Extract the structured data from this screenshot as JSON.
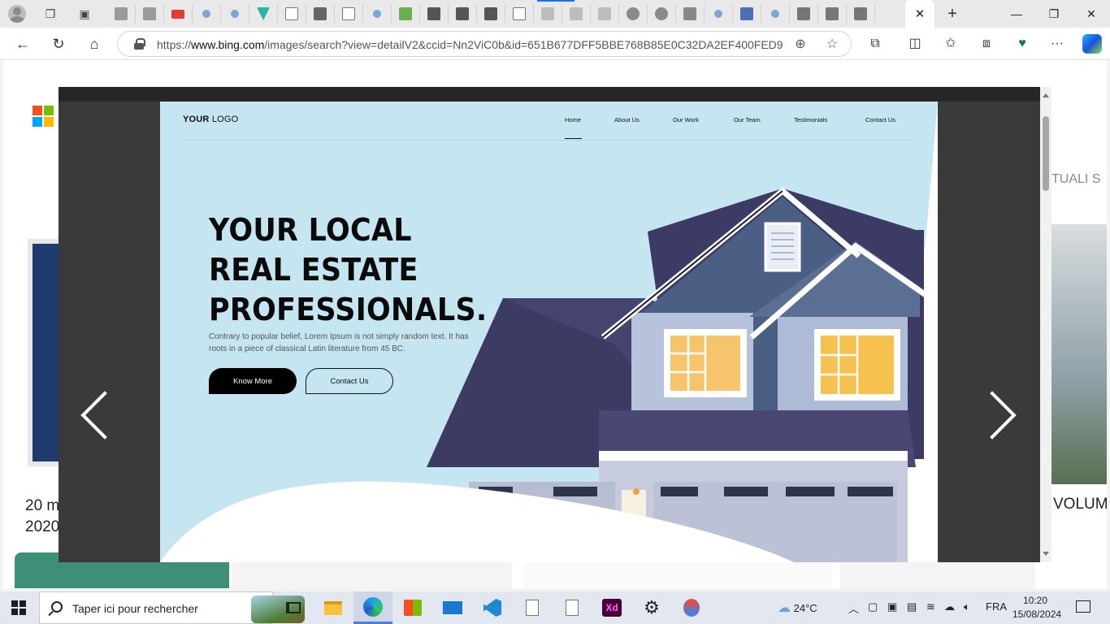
{
  "browser": {
    "url_prefix": "https://",
    "url_host": "www.bing.com",
    "url_rest": "/images/search?view=detailV2&ccid=Nn2ViC0b&id=651B677DFF5BBE768B85E0C32DA2EF400FED93...",
    "active_tab_close": "✕",
    "new_tab": "+",
    "window_controls": {
      "minimize": "—",
      "maximize": "❐",
      "close": "✕"
    },
    "nav": {
      "back": "←",
      "refresh": "↻",
      "home": "⌂"
    },
    "toolbar_icons": {
      "zoom": "⊕",
      "favorite": "☆",
      "extensions": "⧉",
      "split": "◫",
      "favorites": "✩",
      "collections": "⧈",
      "more": "···"
    }
  },
  "background_page": {
    "caption_left": "20 m 2020",
    "caption_right": "VOLUM",
    "tab_right": "TUALI   S"
  },
  "viewer": {
    "prev_label": "",
    "next_label": ""
  },
  "mockup": {
    "logo_bold": "YOUR",
    "logo_light": " LOGO",
    "nav": [
      "Home",
      "About Us",
      "Our Work",
      "Our Team",
      "Testimonials",
      "Contact Us"
    ],
    "headline": [
      "YOUR LOCAL",
      "REAL ESTATE",
      "PROFESSIONALS."
    ],
    "description": "Contrary to popular belief, Lorem Ipsum is not simply random text. It has roots in a piece of classical Latin literature from 45 BC.",
    "primary_button": "Know More",
    "secondary_button": "Contact Us"
  },
  "taskbar": {
    "search_placeholder": "Taper ici pour rechercher",
    "weather": "24°C",
    "language": "FRA",
    "time": "10:20",
    "date": "15/08/2024"
  }
}
